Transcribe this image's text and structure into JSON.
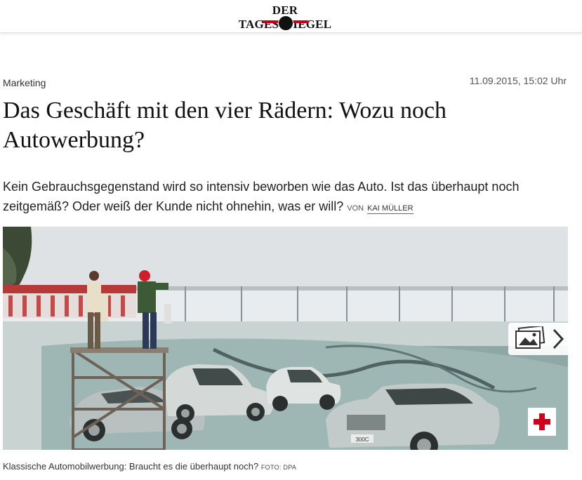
{
  "header": {
    "logo_text": "DER TAGESSPIEGEL",
    "brand_color": "#c4001a"
  },
  "article": {
    "kicker": "Marketing",
    "date": "11.09.2015, 15:02 Uhr",
    "headline": "Das Geschäft mit den vier Rädern: Wozu noch Autowerbung?",
    "teaser": "Kein Gebrauchsgegenstand wird so intensiv beworben wie das Auto. Ist das überhaupt noch zeitgemäß? Oder weiß der Kunde nicht ohnehin, was er will?",
    "byline_prefix": "VON",
    "author": "KAI MÜLLER"
  },
  "image": {
    "billboard_plate": "300C",
    "gallery_icon": "image-stack-icon",
    "next_icon": "chevron-right-icon",
    "share_icon": "plus-icon",
    "share_color": "#d0021b",
    "caption": "Klassische Automobilwerbung: Braucht es die überhaupt noch?",
    "credit": "FOTO: DPA"
  }
}
